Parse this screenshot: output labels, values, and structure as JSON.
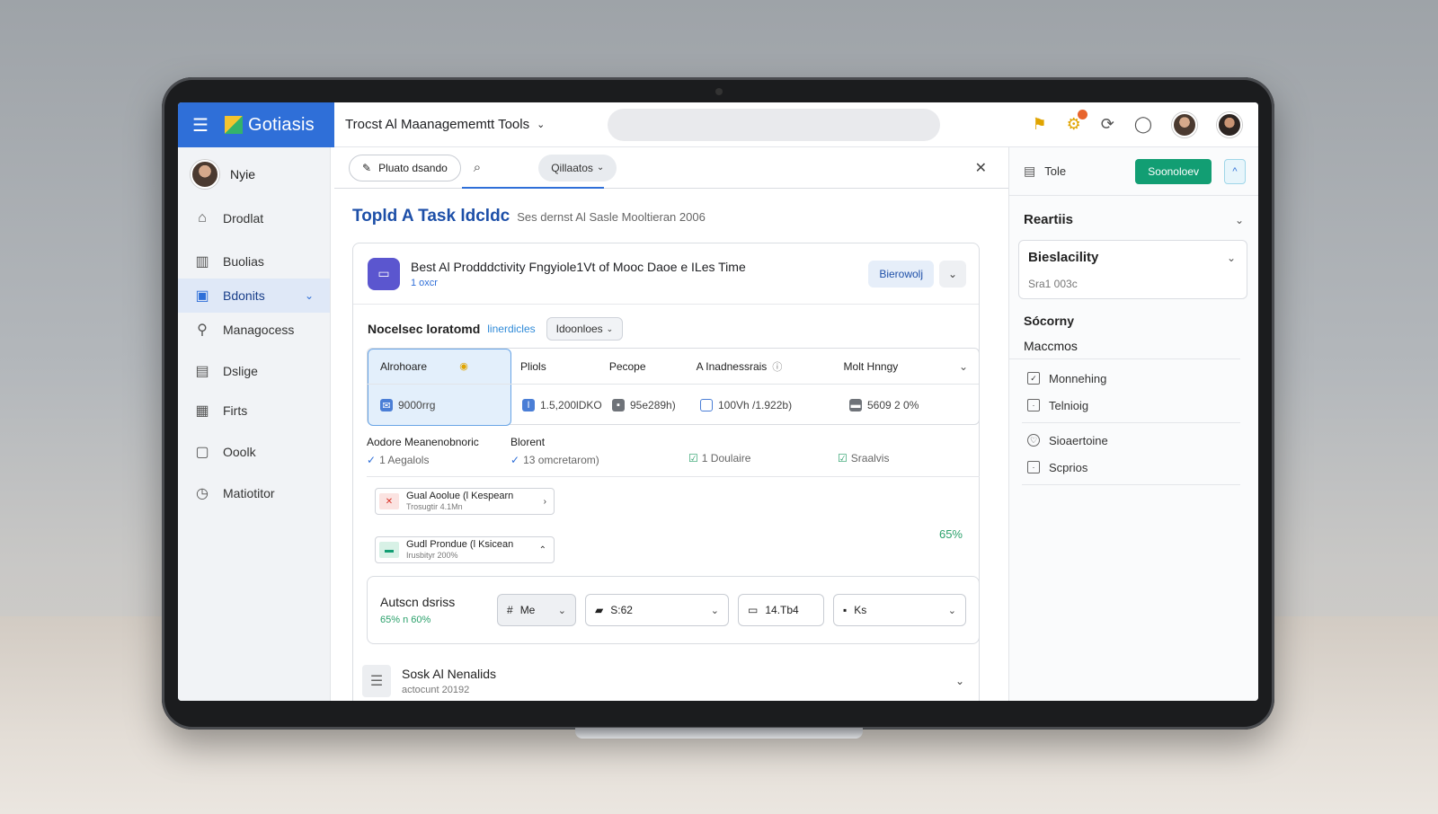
{
  "brand": {
    "name": "Gotiasis"
  },
  "topbar": {
    "title": "Trocst Al Maanagememtt Tools"
  },
  "sidebar": {
    "user": "Nyie",
    "items": [
      {
        "label": "Drodlat",
        "icon": "home-icon"
      },
      {
        "label": "Buolias",
        "icon": "building-icon"
      },
      {
        "label": "Bdonits",
        "icon": "dashboard-icon",
        "active": true
      },
      {
        "label": "Managocess",
        "icon": "pin-icon"
      },
      {
        "label": "Dslige",
        "icon": "document-icon"
      },
      {
        "label": "Firts",
        "icon": "chart-icon"
      },
      {
        "label": "Ooolk",
        "icon": "clipboard-icon"
      },
      {
        "label": "Matiotitor",
        "icon": "clock-icon"
      }
    ]
  },
  "main": {
    "toolbar": {
      "new_label": "Pluato dsando",
      "tab_label": "Qillaatos"
    },
    "page_title": "Topld A Task ldcldc",
    "page_subtitle": "Ses dernst Al Sasle Mooltieran 2006",
    "card": {
      "title": "Best Al Prodddctivity Fngyiole1Vt of Mooc Daoe e ILes Time",
      "subtitle": "1 oxcr",
      "dropdown_label": "Bierowolj",
      "section_title": "Nocelsec loratomd",
      "section_link": "linerdicles",
      "section_dropdown": "Idoonloes",
      "grid": {
        "headers": [
          "Alrohoare",
          "Pliols",
          "Pecope",
          "A Inadnessrais",
          "Molt Hnngy"
        ],
        "values": [
          "9000rrg",
          "1.5,200lDKO",
          "95e289h)",
          "100Vh /1.922b)",
          "5609 2 0%"
        ]
      },
      "subrow": [
        {
          "title": "Aodore Meanenobnoric",
          "status": "1 Aegalols"
        },
        {
          "title": "Blorent",
          "status": "13 omcretarom)"
        },
        {
          "title": "",
          "status": "1 Doulaire"
        },
        {
          "title": "",
          "status": "Sraalvis"
        }
      ],
      "mini_cards": [
        {
          "title": "Gual Aoolue (l Kespearn",
          "sub": "Trosugtir 4.1Mn"
        },
        {
          "title": "Gudl Prondue (l Ksicean",
          "sub": "Irusbityr 200%"
        }
      ],
      "percent": "65%",
      "controls": {
        "label": "Autscn dsriss",
        "sublabel": "65% n 60%",
        "items": [
          "Me",
          "S:62",
          "14.Tb4",
          "Ks"
        ]
      },
      "last_row": {
        "title": "Sosk Al Nenalids",
        "sub": "actocunt 20192"
      }
    }
  },
  "right_panel": {
    "top_label": "Tole",
    "primary_button": "Soonoloev",
    "section1": "Reartiis",
    "card_title": "Bieslacility",
    "card_sub": "Sra1 003c",
    "section2": "Sócorny",
    "section3": "Maccmos",
    "items_a": [
      "Monnehing",
      "Telnioig"
    ],
    "items_b": [
      "Sioaertoine",
      "Scprios"
    ]
  },
  "colors": {
    "accent": "#2f6fd8",
    "success": "#129e73",
    "app_icon": "#5b56cf"
  }
}
